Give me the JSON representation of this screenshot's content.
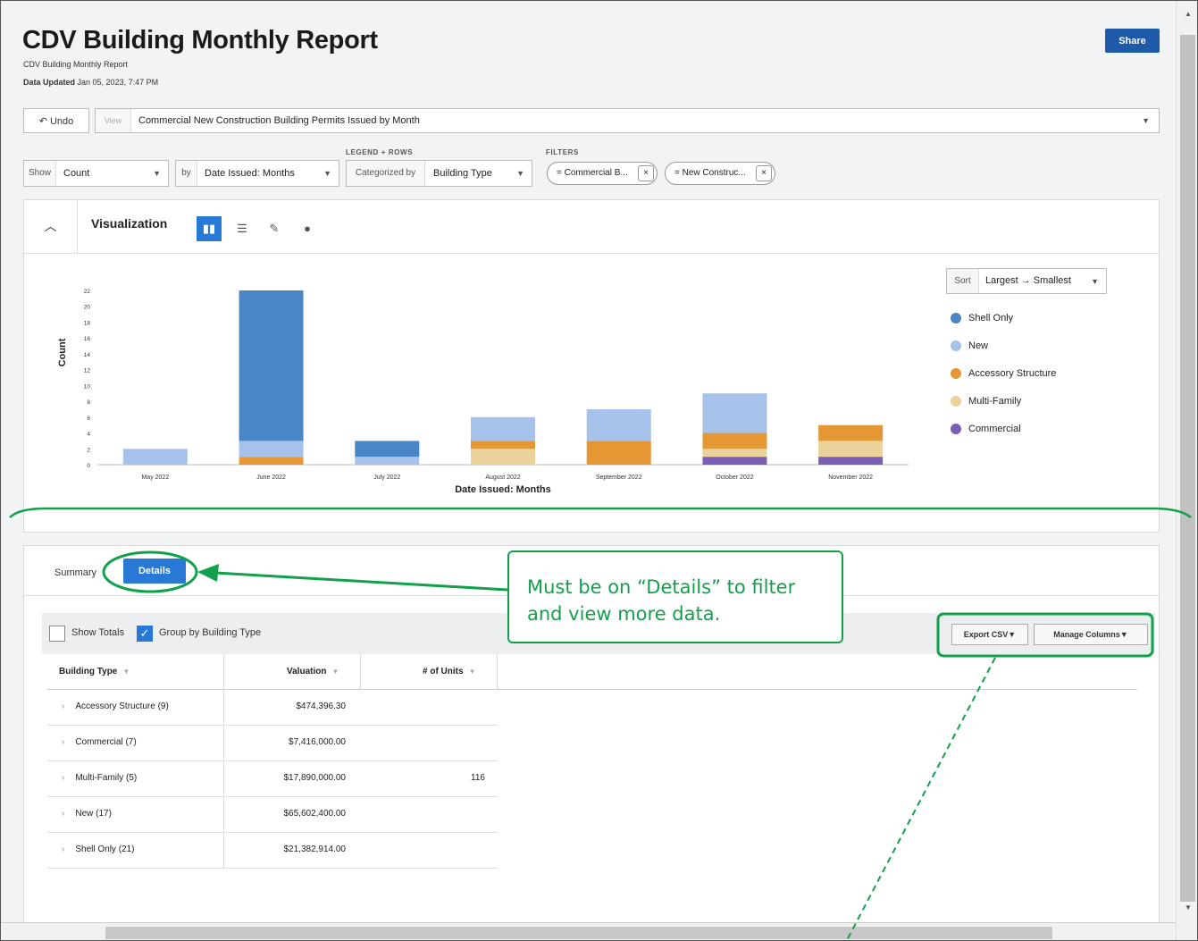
{
  "report": {
    "title": "CDV Building Monthly Report",
    "subtitle": "CDV Building Monthly Report",
    "updated_label": "Data Updated",
    "updated_value": "Jan 05, 2023, 7:47 PM",
    "share_label": "Share"
  },
  "view_bar": {
    "undo_label": "Undo",
    "view_label": "View",
    "view_value": "Commercial New Construction Building Permits Issued by Month"
  },
  "controls": {
    "legend_rows_label": "LEGEND + ROWS",
    "filters_label": "FILTERS",
    "show_label": "Show",
    "show_value": "Count",
    "by_label": "by",
    "by_value": "Date Issued: Months",
    "categorized_label": "Categorized by",
    "categorized_value": "Building Type",
    "filter_1": "= Commercial B...",
    "filter_2": "= New Construc..."
  },
  "visualization": {
    "title": "Visualization",
    "icons": [
      "bar-chart-icon",
      "list-icon",
      "chart-edit-icon",
      "pie-chart-icon"
    ],
    "sort_label": "Sort",
    "sort_value": "Largest → Smallest"
  },
  "chart_data": {
    "type": "bar",
    "stacked": true,
    "xlabel": "Date Issued: Months",
    "ylabel": "Count",
    "ylim": [
      0,
      22
    ],
    "yticks": [
      0,
      2,
      4,
      6,
      8,
      10,
      12,
      14,
      16,
      18,
      20,
      22
    ],
    "categories": [
      "May 2022",
      "June 2022",
      "July 2022",
      "August 2022",
      "September 2022",
      "October 2022",
      "November 2022"
    ],
    "series": [
      {
        "name": "Commercial",
        "color": "#7b5fb5",
        "values": [
          0,
          0,
          0,
          0,
          0,
          1,
          1
        ]
      },
      {
        "name": "Multi-Family",
        "color": "#ead29a",
        "values": [
          0,
          0,
          0,
          2,
          0,
          1,
          2
        ]
      },
      {
        "name": "Accessory Structure",
        "color": "#e59734",
        "values": [
          0,
          1,
          0,
          1,
          3,
          2,
          2
        ]
      },
      {
        "name": "New",
        "color": "#a6c1ea",
        "values": [
          2,
          2,
          1,
          3,
          4,
          5,
          0
        ]
      },
      {
        "name": "Shell Only",
        "color": "#4a86c6",
        "values": [
          0,
          19,
          2,
          0,
          0,
          0,
          0
        ]
      }
    ],
    "legend_order": [
      "Shell Only",
      "New",
      "Accessory Structure",
      "Multi-Family",
      "Commercial"
    ],
    "legend_position": "right",
    "grid": false
  },
  "details": {
    "tab_summary": "Summary",
    "tab_details": "Details",
    "show_totals_label": "Show Totals",
    "show_totals_checked": false,
    "group_by_label": "Group by Building Type",
    "group_by_checked": true,
    "export_label": "Export CSV▼",
    "manage_label": "Manage Columns▼",
    "columns": [
      "Building Type",
      "Valuation",
      "# of Units"
    ],
    "rows": [
      {
        "type": "Accessory Structure (9)",
        "valuation": "$474,396.30",
        "units": ""
      },
      {
        "type": "Commercial (7)",
        "valuation": "$7,416,000.00",
        "units": ""
      },
      {
        "type": "Multi-Family (5)",
        "valuation": "$17,890,000.00",
        "units": "116"
      },
      {
        "type": "New (17)",
        "valuation": "$65,602,400.00",
        "units": ""
      },
      {
        "type": "Shell Only (21)",
        "valuation": "$21,382,914.00",
        "units": ""
      }
    ]
  },
  "annotation": {
    "text": "Must be on “Details” to filter and view more data.",
    "color": "#12a14a"
  }
}
